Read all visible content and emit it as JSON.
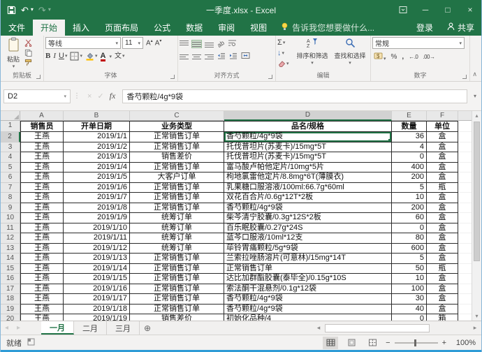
{
  "title_bar": {
    "title": "一季度.xlsx - Excel"
  },
  "menu": {
    "tabs": [
      "文件",
      "开始",
      "插入",
      "页面布局",
      "公式",
      "数据",
      "审阅",
      "视图"
    ],
    "active_tab": "开始",
    "tell_me": "告诉我您想要做什么...",
    "sign_in": "登录",
    "share": "共享"
  },
  "ribbon": {
    "clipboard": {
      "label": "剪贴板",
      "paste": "粘贴"
    },
    "font": {
      "label": "字体",
      "name": "等线",
      "size": "11",
      "bold": "B",
      "italic": "I",
      "underline": "U"
    },
    "alignment": {
      "label": "对齐方式"
    },
    "editing": {
      "label": "编辑",
      "sort_filter": "排序和筛选",
      "find_select": "查找和选择"
    },
    "number": {
      "label": "数字",
      "format": "常规",
      "percent": "%",
      "comma": ",",
      "increase_decimal": "←.0",
      "decrease_decimal": ".00→"
    }
  },
  "formula_bar": {
    "name_box": "D2",
    "content": "香芍颗粒/4g*9袋"
  },
  "sheet": {
    "selected_cell": "D2",
    "selected_column": "D",
    "selected_row": 2,
    "column_letters": [
      "A",
      "B",
      "C",
      "D",
      "E",
      "F"
    ],
    "header_row": [
      "销售员",
      "开单日期",
      "业务类型",
      "品名/规格",
      "数量",
      "单位"
    ],
    "rows": [
      [
        "王燕",
        "2019/1/1",
        "正常销售订单",
        "香芍颗粒/4g*9袋",
        "36",
        "盒"
      ],
      [
        "王燕",
        "2019/1/2",
        "正常销售订单",
        "托伐普坦片(苏麦卡)/15mg*5T",
        "4",
        "盒"
      ],
      [
        "王燕",
        "2019/1/3",
        "销售差价",
        "托伐普坦片(苏麦卡)/15mg*5T",
        "0",
        "盒"
      ],
      [
        "王燕",
        "2019/1/4",
        "正常销售订单",
        "富马酸卢帕他定片/10mg*5片",
        "400",
        "盒"
      ],
      [
        "王燕",
        "2019/1/5",
        "大客户订单",
        "枸地氯雷他定片/8.8mg*6T(薄膜衣)",
        "200",
        "盒"
      ],
      [
        "王燕",
        "2019/1/6",
        "正常销售订单",
        "乳果糖口服溶液/100ml:66.7g*60ml",
        "5",
        "瓶"
      ],
      [
        "王燕",
        "2019/1/7",
        "正常销售订单",
        "双花百合片/0.6g*12T*2板",
        "10",
        "盒"
      ],
      [
        "王燕",
        "2019/1/8",
        "正常销售订单",
        "香芍颗粒/4g*9袋",
        "200",
        "盒"
      ],
      [
        "王燕",
        "2019/1/9",
        "统筹订单",
        "柴芩清宁胶囊/0.3g*12S*2板",
        "60",
        "盒"
      ],
      [
        "王燕",
        "2019/1/10",
        "统筹订单",
        "百乐眠胶囊/0.27g*24S",
        "0",
        "盒"
      ],
      [
        "王燕",
        "2019/1/11",
        "统筹订单",
        "蓝芩口服液/10ml*12支",
        "80",
        "盒"
      ],
      [
        "王燕",
        "2019/1/12",
        "统筹订单",
        "荜铃胃痛颗粒/5g*9袋",
        "600",
        "盒"
      ],
      [
        "王燕",
        "2019/1/13",
        "正常销售订单",
        "兰索拉唑肠溶片(可意林)/15mg*14T",
        "5",
        "盒"
      ],
      [
        "王燕",
        "2019/1/14",
        "正常销售订单",
        "正常销售订单",
        "50",
        "瓶"
      ],
      [
        "王燕",
        "2019/1/15",
        "正常销售订单",
        "达比加群酯胶囊(泰毕全)/0.15g*10S",
        "10",
        "盒"
      ],
      [
        "王燕",
        "2019/1/16",
        "正常销售订单",
        "索法酮干混悬剂/0.1g*12袋",
        "100",
        "盒"
      ],
      [
        "王燕",
        "2019/1/17",
        "正常销售订单",
        "香芍颗粒/4g*9袋",
        "30",
        "盒"
      ],
      [
        "王燕",
        "2019/1/18",
        "正常销售订单",
        "香芍颗粒/4g*9袋",
        "40",
        "盒"
      ],
      [
        "王燕",
        "2019/1/19",
        "销售差价",
        "初始化品种/4",
        "0",
        "箱"
      ]
    ]
  },
  "tabs_bar": {
    "sheets": [
      "一月",
      "二月",
      "三月"
    ],
    "active": "一月"
  },
  "status_bar": {
    "ready": "就绪",
    "zoom": "100%"
  },
  "colors": {
    "accent_green": "#217346",
    "active_cell_border": "#217346",
    "window_edge_blue": "#2e9bd6"
  },
  "icons": {
    "dropdown": "▾",
    "undo": "↶",
    "redo": "↷",
    "qat_more": "▾",
    "minimize": "─",
    "maximize": "□",
    "close": "×",
    "cancel": "×",
    "enter": "✓",
    "fx": "fx",
    "sum": "Σ",
    "fill_down": "↓",
    "collapse": "∧",
    "nav_left": "◂",
    "nav_right": "▸",
    "scroll_up": "▴",
    "scroll_down": "▾",
    "new_sheet": "⊕",
    "zoom_out": "−",
    "zoom_in": "+",
    "grow_font": "A",
    "shrink_font": "A",
    "phonetic": "文",
    "orientation": "ab"
  }
}
